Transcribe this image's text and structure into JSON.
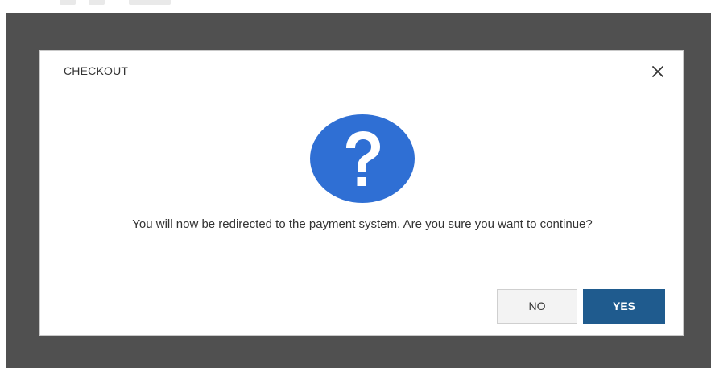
{
  "dialog": {
    "title": "CHECKOUT",
    "message": "You will now be redirected to the payment system. Are you sure you want to continue?",
    "icon": "question-icon",
    "close_icon": "close-icon",
    "no_label": "NO",
    "yes_label": "YES"
  },
  "colors": {
    "overlay": "#505050",
    "accent_icon": "#2f6fd4",
    "primary_button": "#1f5b8e",
    "secondary_button": "#f3f3f3"
  }
}
